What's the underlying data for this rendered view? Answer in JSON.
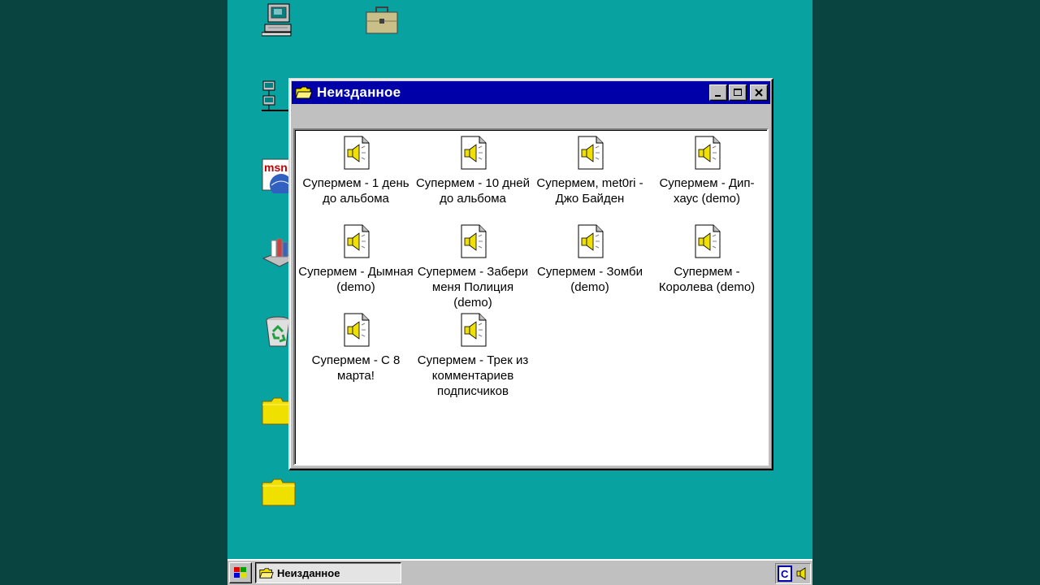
{
  "desktop": {
    "background_color": "#08a3a0",
    "outer_color": "#0a4440",
    "icons": [
      {
        "name": "my-computer-icon"
      },
      {
        "name": "briefcase-icon"
      },
      {
        "name": "network-neighborhood-icon"
      },
      {
        "name": "msn-icon",
        "text": "msn"
      },
      {
        "name": "inbox-icon"
      },
      {
        "name": "recycle-bin-icon"
      },
      {
        "name": "folder-icon"
      },
      {
        "name": "folder-icon"
      }
    ]
  },
  "window": {
    "title": "Неизданное",
    "title_icon": "folder-open-icon",
    "titlebar_color": "#0000a8",
    "buttons": [
      "minimize",
      "maximize",
      "close"
    ],
    "files": [
      {
        "label": "Супермем - 1 день до альбома",
        "icon": "sound-file-icon"
      },
      {
        "label": "Супермем - 10 дней до альбома",
        "icon": "sound-file-icon"
      },
      {
        "label": "Супермем, met0ri - Джо Байден",
        "icon": "sound-file-icon"
      },
      {
        "label": "Супермем - Дип-хаус (demo)",
        "icon": "sound-file-icon"
      },
      {
        "label": "Супермем - Дымная (demo)",
        "icon": "sound-file-icon"
      },
      {
        "label": "Супермем - Забери меня Полиция (demo)",
        "icon": "sound-file-icon"
      },
      {
        "label": "Супермем - Зомби (demo)",
        "icon": "sound-file-icon"
      },
      {
        "label": "Супермем - Королева (demo)",
        "icon": "sound-file-icon"
      },
      {
        "label": "Супермем - С 8 марта!",
        "icon": "sound-file-icon"
      },
      {
        "label": "Супермем - Трек из комментариев подписчиков",
        "icon": "sound-file-icon"
      }
    ]
  },
  "taskbar": {
    "start_icon": "windows-logo-icon",
    "task_label": "Неизданное",
    "tray_icons": [
      "c-icon",
      "speaker-icon"
    ],
    "tray_c": "C"
  }
}
